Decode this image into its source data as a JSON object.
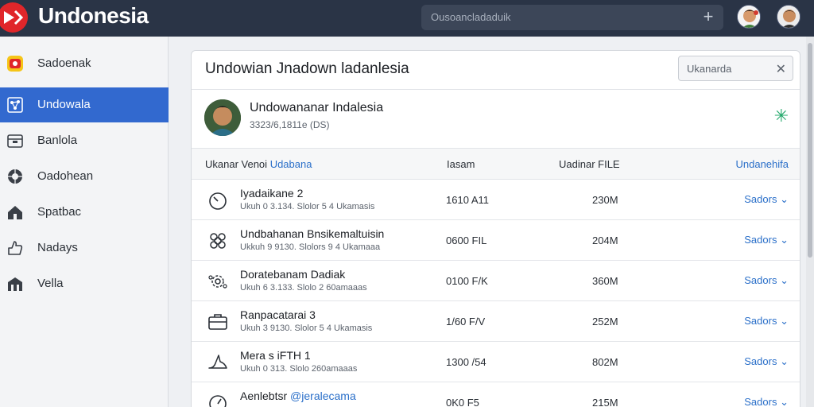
{
  "app": {
    "title": "Undonesia"
  },
  "search": {
    "value": "Ousoancladaduik"
  },
  "sidebar": {
    "items": [
      {
        "label": "Sadoenak",
        "icon": "app-badge-icon",
        "active": false
      },
      {
        "label": "Undowala",
        "icon": "network-icon",
        "active": true
      },
      {
        "label": "Banlola",
        "icon": "box-icon",
        "active": false
      },
      {
        "label": "Oadohean",
        "icon": "globe-icon",
        "active": false
      },
      {
        "label": "Spatbac",
        "icon": "house-icon",
        "active": false
      },
      {
        "label": "Nadays",
        "icon": "thumb-icon",
        "active": false
      },
      {
        "label": "Vella",
        "icon": "building-icon",
        "active": false
      }
    ]
  },
  "panel": {
    "title": "Undowian Jnadown ladanlesia",
    "filter_value": "Ukanarda",
    "profile": {
      "name": "Undowananar Indalesia",
      "subtitle": "3323/6,1811e (DS)"
    },
    "columns": {
      "name_prefix": "Ukanar Venoi",
      "name_accent": "Udabana",
      "col2": "Iasam",
      "col3": "Uadinar FILE",
      "col4": "Undanehifa"
    },
    "rows": [
      {
        "icon": "timer-icon",
        "title": "Iyadaikane 2",
        "title_accent": "",
        "sub": "Ukuh 0 3.134. Slolor 5 4 Ukamasis",
        "col2": "1610 A11",
        "col3": "230M",
        "action": "Sadors"
      },
      {
        "icon": "gear-icon",
        "title": "Undbahanan Bnsikemaltuisin",
        "title_accent": "",
        "sub": "Ukkuh 9 9130. Slolors 9 4 Ukamaaa",
        "col2": "0600 FIL",
        "col3": "204M",
        "action": "Sadors"
      },
      {
        "icon": "cog-cluster-icon",
        "title": "Doratebanam Dadiak",
        "title_accent": "",
        "sub": "Ukuh 6 3.133. Slolo 2 60amaaas",
        "col2": "0100 F/K",
        "col3": "360M",
        "action": "Sadors"
      },
      {
        "icon": "briefcase-icon",
        "title": "Ranpacatarai 3",
        "title_accent": "",
        "sub": "Ukuh 3 9130. Slolor 5 4 Ukamasis",
        "col2": "1/60 F/V",
        "col3": "252M",
        "action": "Sadors"
      },
      {
        "icon": "bird-icon",
        "title": "Mera s iFTH 1",
        "title_accent": "",
        "sub": "Ukuh 0 313. Slolo 260amaaas",
        "col2": "1300 /54",
        "col3": "802M",
        "action": "Sadors"
      },
      {
        "icon": "speedometer-icon",
        "title": "Aenlebtsr ",
        "title_accent": "@jeralecama",
        "sub": "",
        "col2": "0K0 F5",
        "col3": "215M",
        "action": "Sadors"
      }
    ]
  },
  "colors": {
    "topbar": "#2a3446",
    "accent": "#3269cf",
    "link": "#2a6fc9",
    "star": "#23a86b",
    "logo": "#e0262a"
  }
}
